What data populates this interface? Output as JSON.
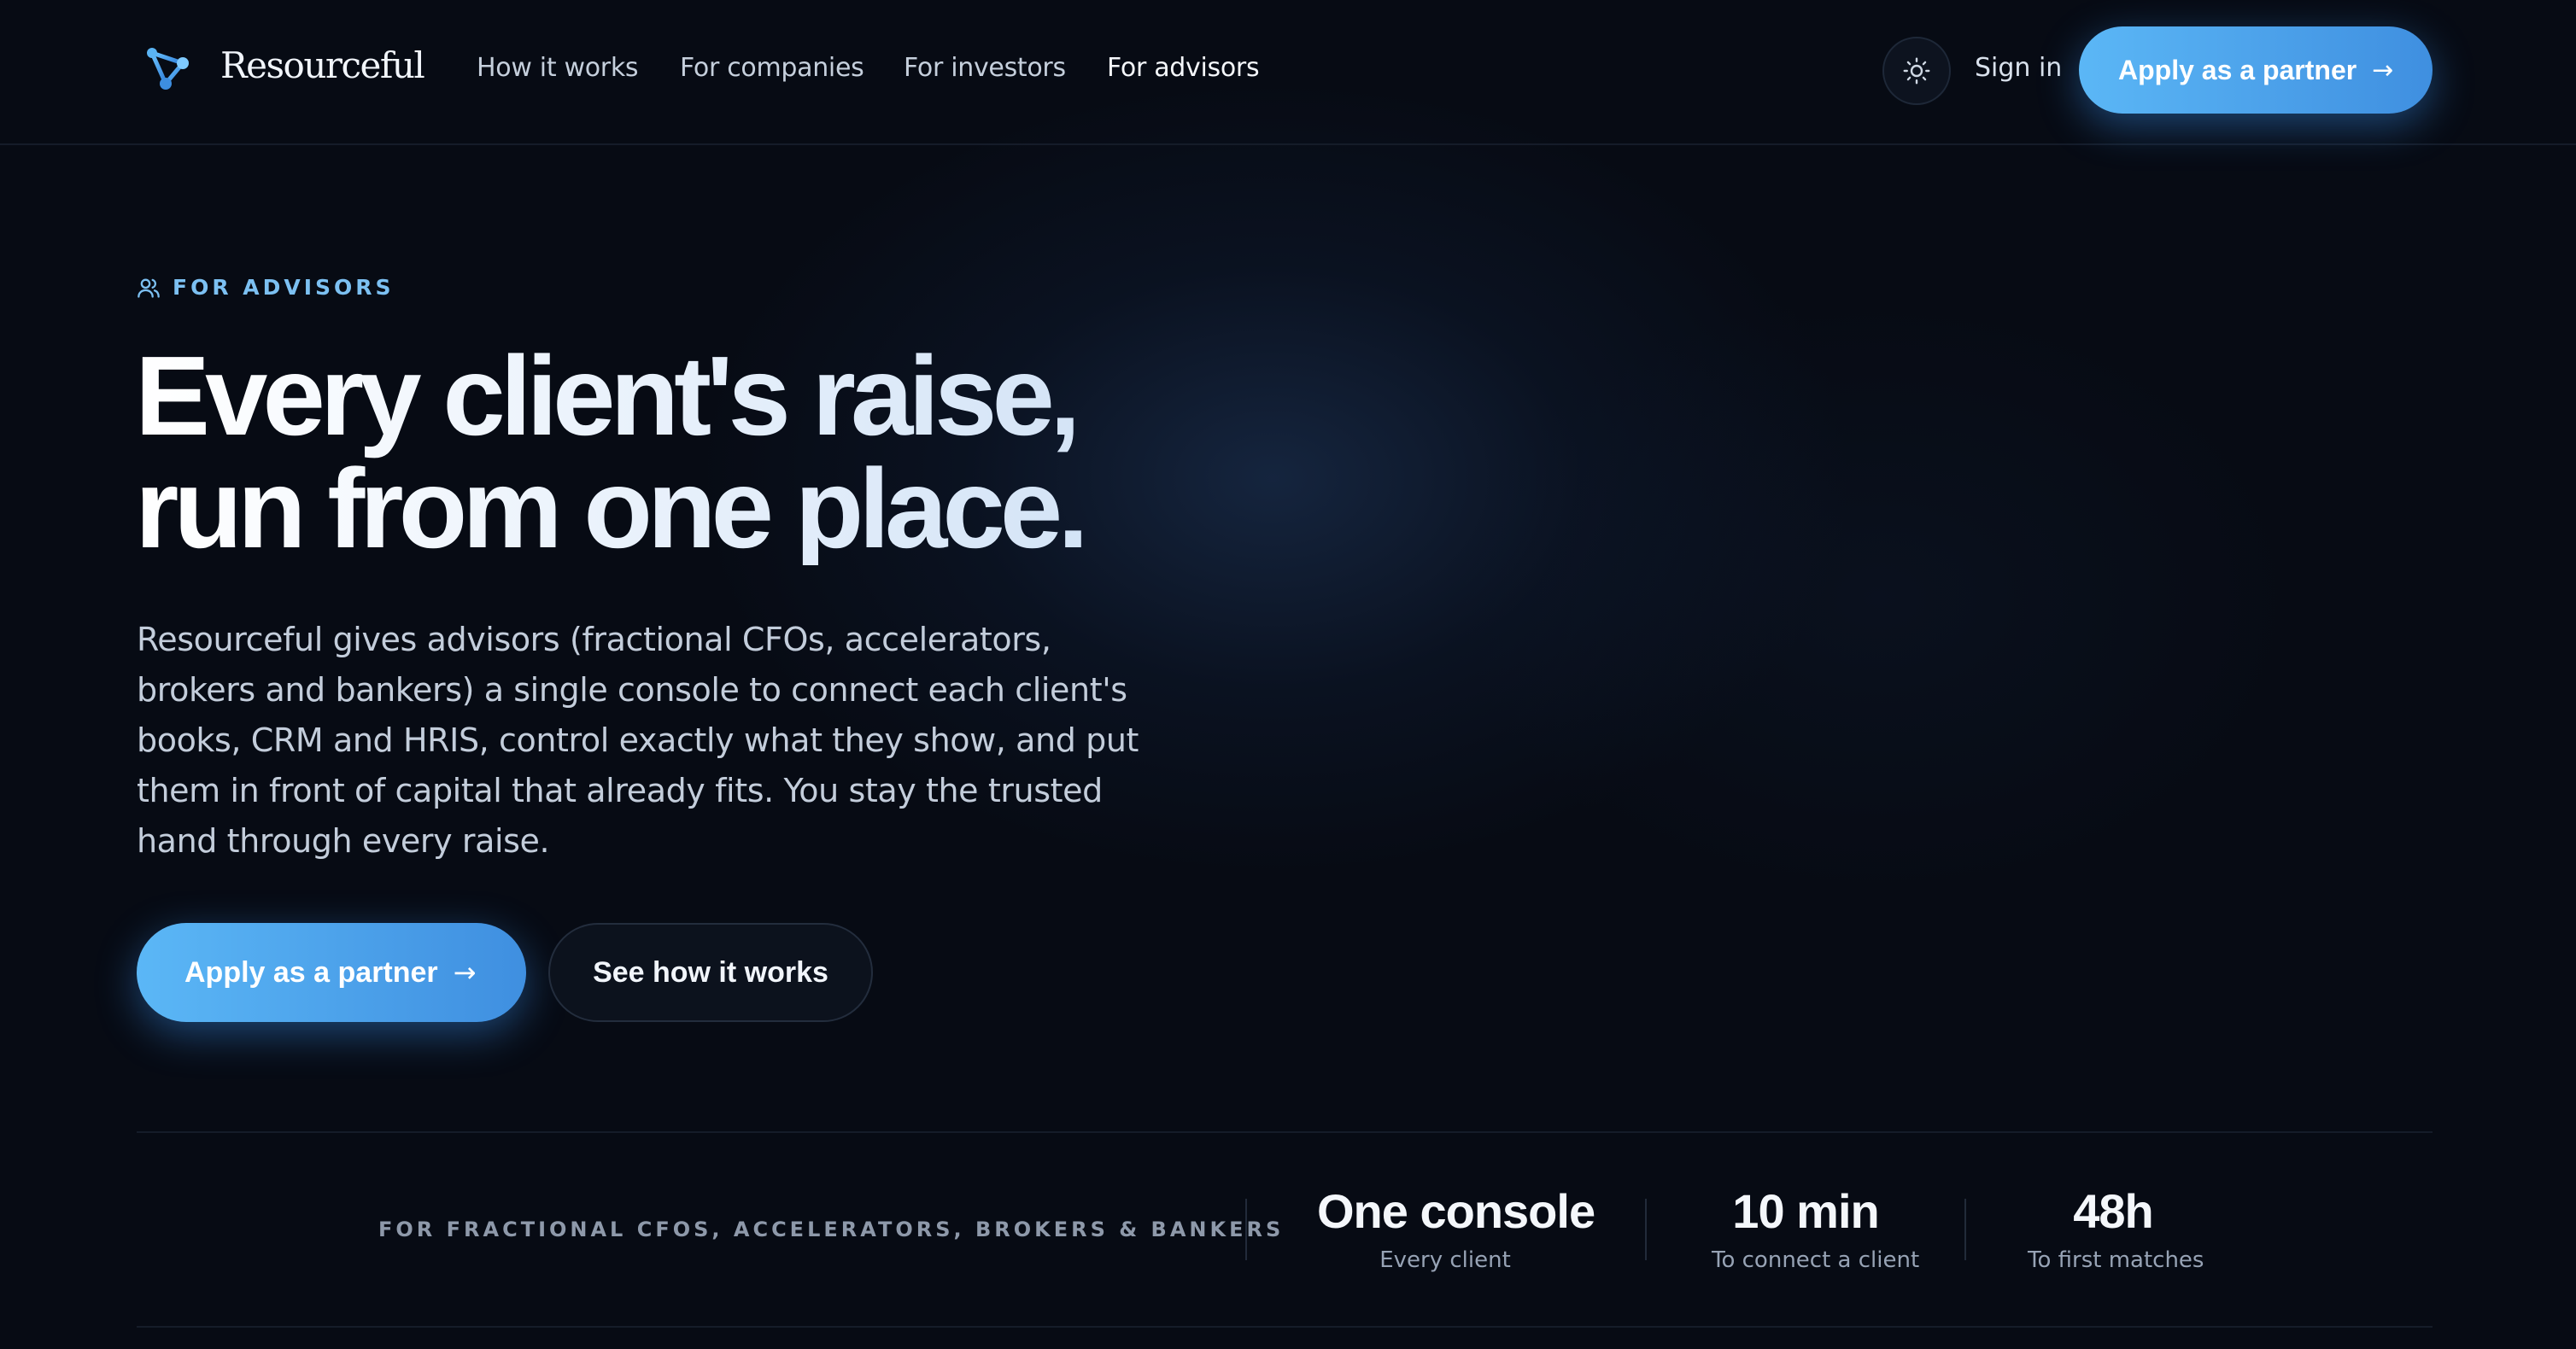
{
  "nav": {
    "brand": "Resourceful",
    "links": [
      {
        "label": "How it works"
      },
      {
        "label": "For companies"
      },
      {
        "label": "For investors"
      },
      {
        "label": "For advisors"
      }
    ],
    "theme_icon": "sun-icon",
    "sign_in": "Sign in",
    "cta": {
      "label": "Apply as a partner",
      "icon": "arrow-right-icon"
    }
  },
  "hero": {
    "eyebrow": {
      "label": "FOR ADVISORS",
      "icon": "users-icon"
    },
    "headline": [
      "Every client's raise,",
      "run from one place."
    ],
    "lede": "Resourceful gives advisors (fractional CFOs, accelerators, brokers and bankers) a single console to connect each client's books, CRM and HRIS, control exactly what they show, and put them in front of capital that already fits. You stay the trusted hand through every raise.",
    "primary_cta": {
      "label": "Apply as a partner",
      "icon": "arrow-right-icon"
    },
    "secondary_cta": {
      "label": "See how it works"
    }
  },
  "stats_bar": {
    "audience": "FOR FRACTIONAL CFOS, ACCELERATORS, BROKERS & BANKERS",
    "stats": [
      {
        "value": "One console",
        "label": "Every client"
      },
      {
        "value": "10 min",
        "label": "To connect a client"
      },
      {
        "value": "48h",
        "label": "To first matches"
      }
    ]
  },
  "colors": {
    "background": "#070b14",
    "accent_start": "#5bb7f6",
    "accent_end": "#3f8fe0",
    "eyebrow": "#7cc0f2"
  }
}
